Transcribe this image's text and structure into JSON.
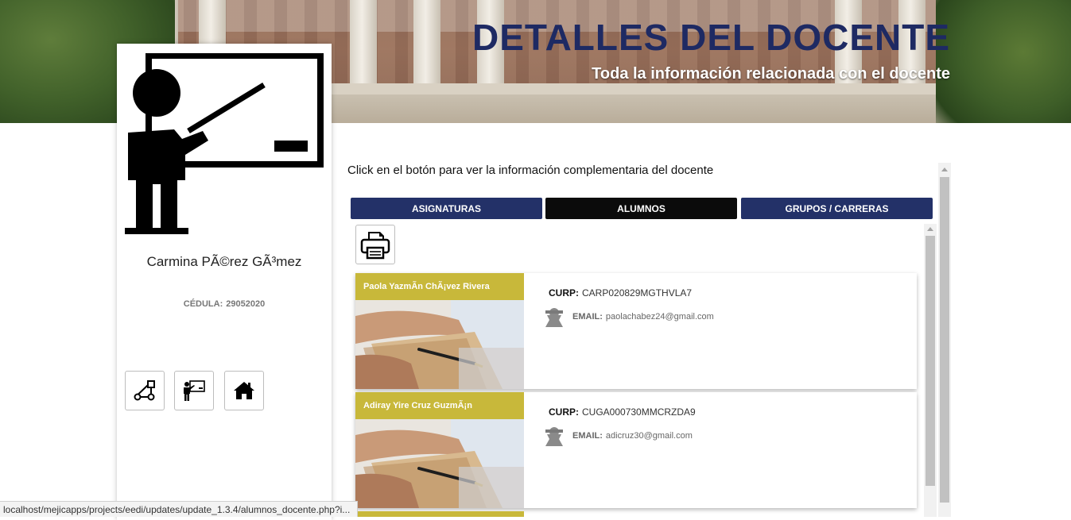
{
  "banner": {
    "title": "DETALLES DEL DOCENTE",
    "subtitle": "Toda la información relacionada con el docente"
  },
  "profile": {
    "name": "Carmina PÃ©rez GÃ³mez",
    "cedula_label": "CÉDULA:",
    "cedula_value": "29052020",
    "buttons": [
      {
        "icon": "workflow-icon"
      },
      {
        "icon": "teacher-icon"
      },
      {
        "icon": "home-icon"
      }
    ]
  },
  "main": {
    "instructions": "Click en el botón para ver la información complementaria del docente",
    "tabs": [
      {
        "label": "ASIGNATURAS",
        "active": false
      },
      {
        "label": "ALUMNOS",
        "active": true
      },
      {
        "label": "GRUPOS / CARRERAS",
        "active": false
      }
    ],
    "print_icon": "printer-icon",
    "curp_label": "CURP:",
    "email_label": "EMAIL:",
    "students": [
      {
        "name": "Paola YazmÃn ChÃ¡vez Rivera",
        "curp": "CARP020829MGTHVLA7",
        "email": "paolachabez24@gmail.com"
      },
      {
        "name": "Adiray Yire Cruz GuzmÃ¡n",
        "curp": "CUGA000730MMCRZDA9",
        "email": "adicruz30@gmail.com"
      }
    ]
  },
  "status_bar": {
    "url": "localhost/mejicapps/projects/eedi/updates/update_1.3.4/alumnos_docente.php?i..."
  },
  "colors": {
    "primary_navy": "#233168",
    "active_tab": "#0b0b0b",
    "name_strip": "#c8b83a"
  }
}
